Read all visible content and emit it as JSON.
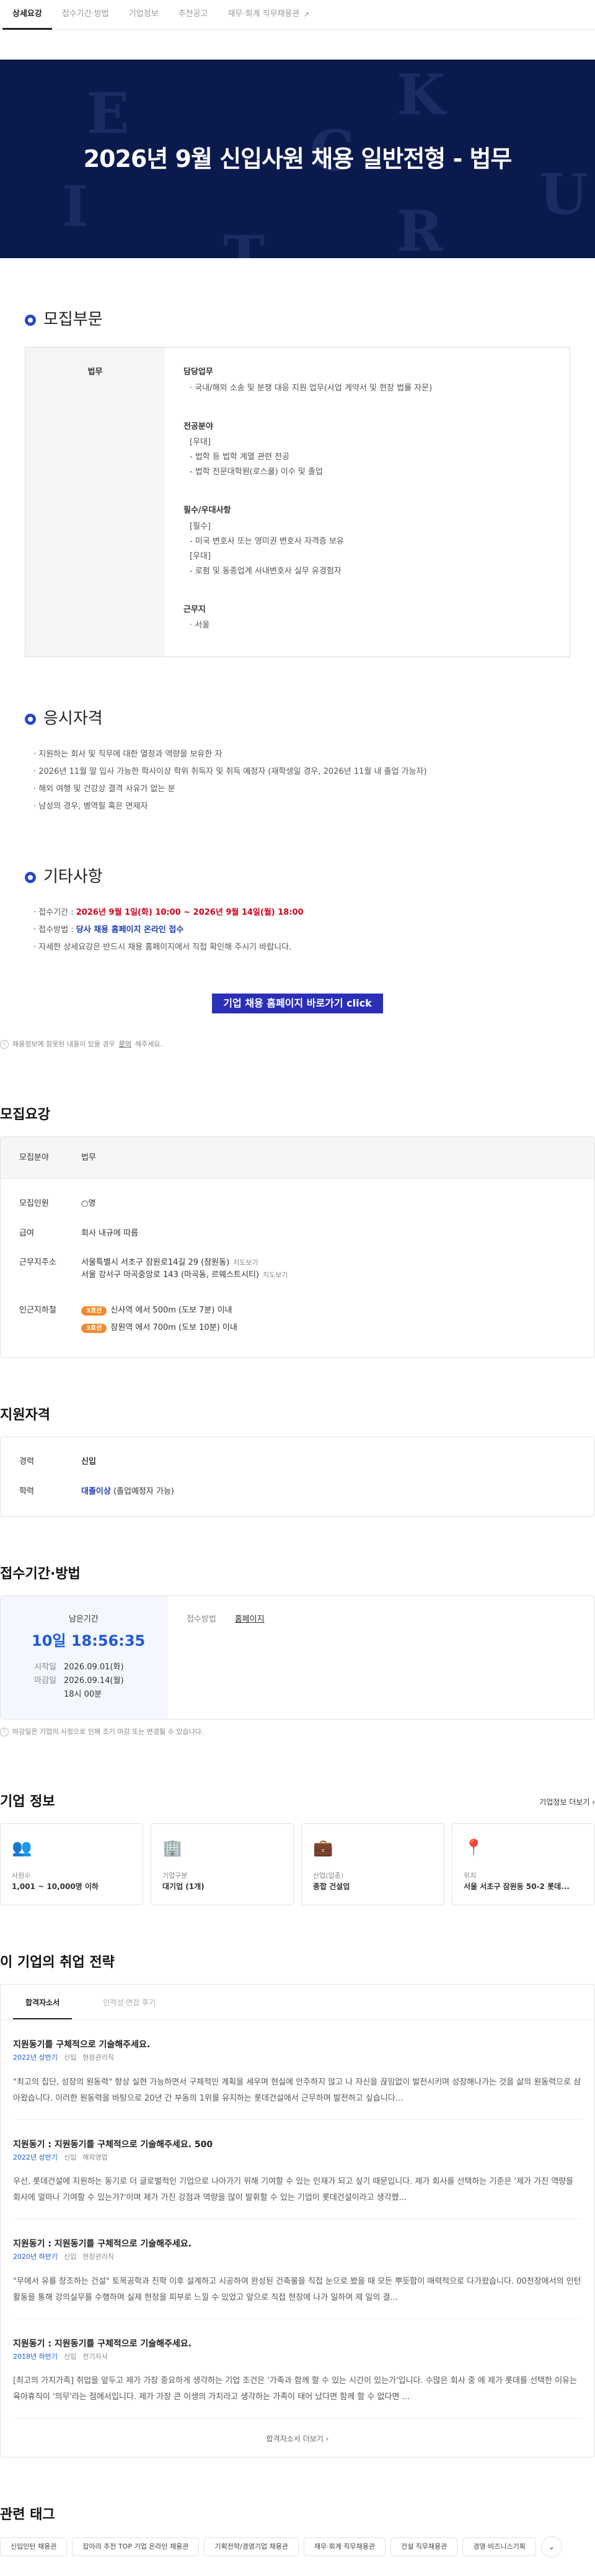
{
  "tabs": [
    {
      "label": "상세요강"
    },
    {
      "label": "접수기간·방법"
    },
    {
      "label": "기업정보"
    },
    {
      "label": "추천공고"
    },
    {
      "label": "재무·회계 직무채용관"
    }
  ],
  "hero": {
    "title": "2026년 9월 신입사원 채용 일반전형 - 법무",
    "bg_letters": [
      "E",
      "K",
      "C",
      "U",
      "I",
      "R",
      "T"
    ]
  },
  "recruit_section": {
    "heading": "모집부문",
    "part": "법무",
    "groups": [
      {
        "title": "담당업무",
        "lines": [
          "· 국내/해외 소송 및 분쟁 대응 지원 업무(사업 계약서 및 현장 법률 자문)"
        ]
      },
      {
        "title": "전공분야",
        "lines": [
          "[우대]",
          "- 법학 등 법학 계열 관련 전공",
          "- 법학 전문대학원(로스쿨) 이수 및 졸업"
        ]
      },
      {
        "title": "필수/우대사항",
        "lines": [
          "[필수]",
          "- 미국 변호사 또는 영미권 변호사 자격증 보유",
          "[우대]",
          "- 로펌 및 동종업계 사내변호사 실무 유경험자"
        ]
      },
      {
        "title": "근무지",
        "lines": [
          "· 서울"
        ]
      }
    ]
  },
  "qualify_section": {
    "heading": "응시자격",
    "items": [
      "· 지원하는 회사 및 직무에 대한 열정과 역량을 보유한 자",
      "· 2026년 11월 말 입사 가능한 학사이상 학위 취득자 및 취득 예정자 (재학생일 경우, 2026년 11월 내 졸업 가능자)",
      "· 해외 여행 및 건강상 결격 사유가 없는 분",
      "· 남성의 경우, 병역필 혹은 면제자"
    ]
  },
  "etc_section": {
    "heading": "기타사항",
    "period_label": "· 접수기간 : ",
    "period_value": "2026년 9월 1일(화) 10:00 ~ 2026년 9월 14일(월) 18:00",
    "method_label": "· 접수방법 : ",
    "method_value": "당사 채용 홈페이지 온라인 접수",
    "detail": "· 자세한 상세요강은 반드시 채용 홈페이지에서 직접 확인해 주시기 바랍니다."
  },
  "cta": {
    "label": "기업 채용 홈페이지 바로가기 click"
  },
  "report_note": {
    "prefix": "채용정보에 잘못된 내용이 있을 경우 ",
    "link": "문의",
    "suffix": "해주세요."
  },
  "summary": {
    "heading": "모집요강",
    "field_label": "모집분야",
    "field_value": "법무",
    "rows": [
      {
        "k": "모집인원",
        "v": "○명"
      },
      {
        "k": "급여",
        "v": "회사 내규에 따름"
      }
    ],
    "addr_label": "근무지주소",
    "addresses": [
      {
        "text": "서울특별시 서초구 잠원로14길 29 (잠원동)",
        "map": "지도보기"
      },
      {
        "text": "서울 강서구 마곡중앙로 143 (마곡동, 르웨스트시티)",
        "map": "지도보기"
      }
    ],
    "subway_label": "인근지하철",
    "subways": [
      {
        "line": "3호선",
        "text": "신사역 에서 500m (도보 7분) 이내"
      },
      {
        "line": "3호선",
        "text": "잠원역 에서 700m (도보 10분) 이내"
      }
    ]
  },
  "eligibility": {
    "heading": "지원자격",
    "career_label": "경력",
    "career_value": "신입",
    "edu_label": "학력",
    "edu_value": "대졸이상",
    "edu_note": " (졸업예정자 가능)"
  },
  "apply": {
    "heading": "접수기간·방법",
    "remain_label": "남은기간",
    "remain_value": "10일 18:56:35",
    "start_label": "시작일",
    "start_value": "2026.09.01(화)",
    "end_label": "마감일",
    "end_value": "2026.09.14(월)",
    "end_time": "18시 00분",
    "method_label": "접수방법",
    "method_value": "홈페이지",
    "note": "마감일은 기업의 사정으로 인해 조기 마감 또는 변경될 수 있습니다."
  },
  "company": {
    "heading": "기업 정보",
    "more": "기업정보 더보기 ›",
    "cards": [
      {
        "icon": "👥",
        "k": "사원수",
        "v": "1,001 ~ 10,000명 이하"
      },
      {
        "icon": "🏢",
        "k": "기업구분",
        "v": "대기업 (1개)"
      },
      {
        "icon": "💼",
        "k": "산업(업종)",
        "v": "종합 건설업"
      },
      {
        "icon": "📍",
        "k": "위치",
        "v": "서울 서초구 잠원동 50-2 롯데..."
      }
    ]
  },
  "strategy": {
    "heading": "이 기업의 취업 전략",
    "tabs": [
      "합격자소서",
      "인적성·면접 후기"
    ],
    "essays": [
      {
        "q": "지원동기를 구체적으로 기술해주세요.",
        "year": "2022년 상반기",
        "type": "신입",
        "job": "현장관리직",
        "text": "\"최고의 집단, 성장의 원동력\" 향상 실현 가능하면서 구체적인 계획을 세우며 현실에 안주하지 않고 나 자신을 끊임없이 발전시키며 성장해나가는 것을 삶의 원동력으로 삼아왔습니다. 이러한 원동력을 바탕으로 20년 간 부동의 1위를 유지하는 롯데건설에서 근무하며 발전하고 싶습니다..."
      },
      {
        "q": "지원동기 : 지원동기를 구체적으로 기술해주세요. 500",
        "year": "2022년 상반기",
        "type": "신입",
        "job": "해외영업",
        "text": "우선, 롯데건설에 지원하는 동기로 더 글로벌적인 기업으로 나아가기 위해 기여할 수 있는 인재가 되고 싶기 때문입니다. 제가 회사를 선택하는 기준은 '제가 가진 역량을 회사에 얼마나 기여할 수 있는가?'이며 제가 가진 강점과 역량을 많이 발휘할 수 있는 기업이 롯데건설이라고 생각했..."
      },
      {
        "q": "지원동기 : 지원동기를 구체적으로 기술해주세요.",
        "year": "2020년 하반기",
        "type": "신입",
        "job": "현장관리직",
        "text": "\"무에서 유를 창조하는 건설\" 토목공학과 진학 이후 설계하고 시공하여 완성된 건축물을 직접 눈으로 봤을 때 모든 뿌듯함이 매력적으로 다가왔습니다. 00천장에서의 인턴 활동을 통해 강의실무를 수행하며 실제 현장을 피부로 느낄 수 있었고 앞으로 직접 현장에 나가 일하며 제 일의 결..."
      },
      {
        "q": "지원동기 : 지원동기를 구체적으로 기술해주세요.",
        "year": "2018년 하반기",
        "type": "신입",
        "job": "전기자사",
        "text": "[최고의 가치가족] 취업을 앞두고 제가 가장 중요하게 생각하는 기업 조건은 '가족과 함께 할 수 있는 시간이 있는가'입니다. 수많은 회사 중 에 제가 롯데를 선택한 이유는 육아휴직이 '의무'라는 점에서입니다. 제가 가장 큰 이생의 가치라고 생각하는 가족이 태어 났다면 함께 할 수 없다면 ..."
      }
    ],
    "more": "합격자소서 더보기 ›"
  },
  "related": {
    "heading": "관련 태그",
    "tags": [
      "신입인턴 채용관",
      "잡아라 추천 TOP 기업 온라인 채용관",
      "기획전략/경영기업 채용관",
      "재무·회계 직무채용관",
      "건설 직무채용관",
      "경영·비즈니스기획"
    ]
  }
}
